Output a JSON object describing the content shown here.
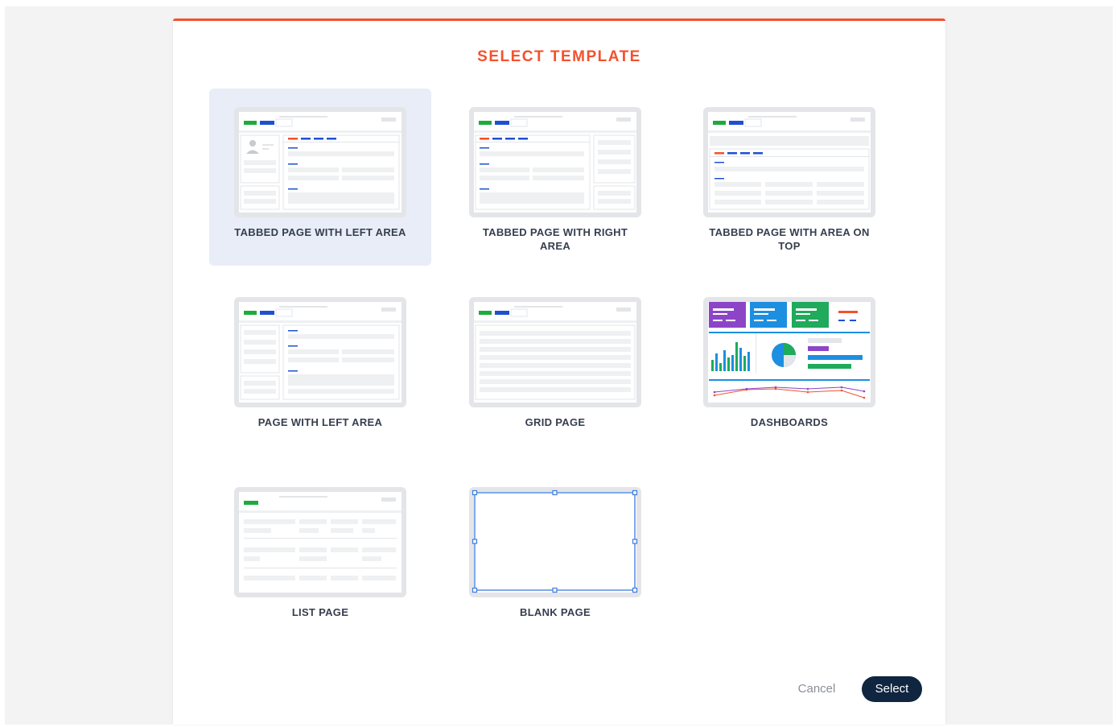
{
  "dialog": {
    "title": "SELECT TEMPLATE",
    "accent_color": "#f4512c",
    "selected_highlight": "#e8edf8",
    "templates": [
      {
        "label": "TABBED PAGE WITH LEFT AREA",
        "icon": "tabbed-left-area-thumbnail",
        "selected": true
      },
      {
        "label": "TABBED PAGE WITH RIGHT AREA",
        "icon": "tabbed-right-area-thumbnail",
        "selected": false
      },
      {
        "label": "TABBED PAGE WITH AREA ON TOP",
        "icon": "tabbed-top-area-thumbnail",
        "selected": false
      },
      {
        "label": "PAGE WITH LEFT AREA",
        "icon": "left-area-thumbnail",
        "selected": false
      },
      {
        "label": "GRID PAGE",
        "icon": "grid-page-thumbnail",
        "selected": false
      },
      {
        "label": "DASHBOARDS",
        "icon": "dashboard-thumbnail",
        "selected": false
      },
      {
        "label": "LIST PAGE",
        "icon": "list-page-thumbnail",
        "selected": false
      },
      {
        "label": "BLANK PAGE",
        "icon": "blank-page-thumbnail",
        "selected": false
      }
    ],
    "buttons": {
      "cancel": "Cancel",
      "select": "Select"
    }
  }
}
